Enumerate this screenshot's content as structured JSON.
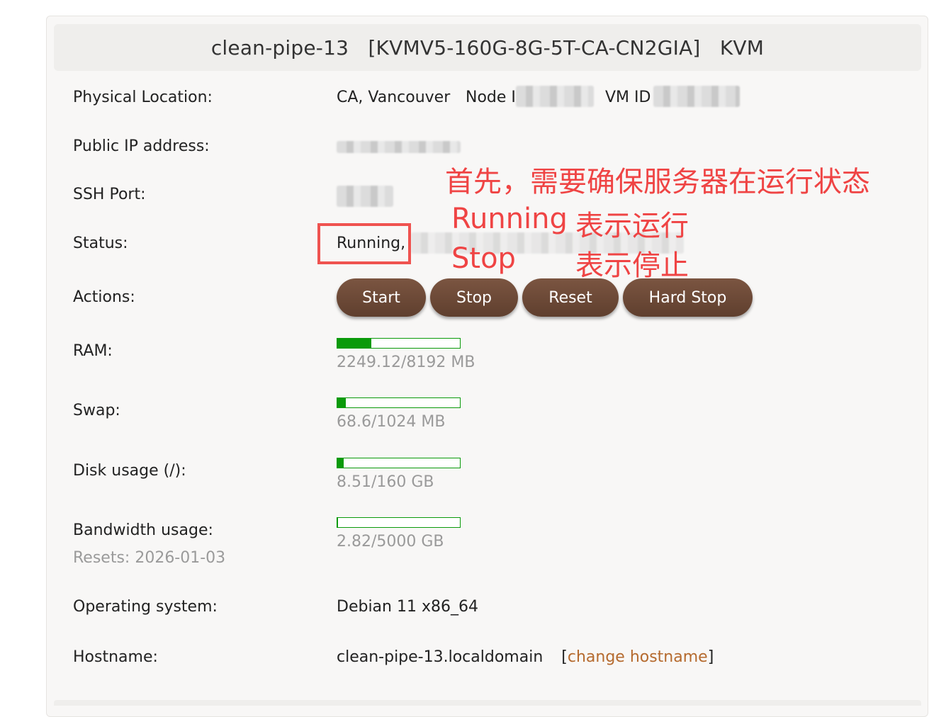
{
  "header": {
    "hostname": "clean-pipe-13",
    "plan": "[KVMV5-160G-8G-5T-CA-CN2GIA]",
    "virtualization": "KVM"
  },
  "location": {
    "label": "Physical Location:",
    "value": "CA, Vancouver",
    "node_label": "Node I",
    "vmid_label": "VM ID"
  },
  "public_ip": {
    "label": "Public IP address:"
  },
  "ssh_port": {
    "label": "SSH Port:"
  },
  "status": {
    "label": "Status:",
    "value": "Running,"
  },
  "actions": {
    "label": "Actions:",
    "start": "Start",
    "stop": "Stop",
    "reset": "Reset",
    "hard_stop": "Hard Stop"
  },
  "ram": {
    "label": "RAM:",
    "text": "2249.12/8192 MB",
    "used_fraction": 0.2746
  },
  "swap": {
    "label": "Swap:",
    "text": "68.6/1024 MB",
    "used_fraction": 0.067
  },
  "disk": {
    "label": "Disk usage (/):",
    "text": "8.51/160 GB",
    "used_fraction": 0.0532
  },
  "bandwidth": {
    "label": "Bandwidth usage:",
    "resets": "Resets: 2026-01-03",
    "text": "2.82/5000 GB",
    "used_fraction": 0.0006
  },
  "os": {
    "label": "Operating system:",
    "value": "Debian 11 x86_64"
  },
  "host": {
    "label": "Hostname:",
    "value": "clean-pipe-13.localdomain",
    "bracket_open": "[",
    "change_link": "change hostname",
    "bracket_close": "]"
  },
  "annotations": {
    "line1": "首先，需要确保服务器在运行状态",
    "running_en": "Running",
    "running_cn": "表示运行",
    "stop_en": "Stop",
    "stop_cn": "表示停止",
    "color": "#ef4444"
  },
  "colors": {
    "button_bg": "#6b4836",
    "bar_green": "#0a9a0a",
    "link": "#b56a2e"
  }
}
